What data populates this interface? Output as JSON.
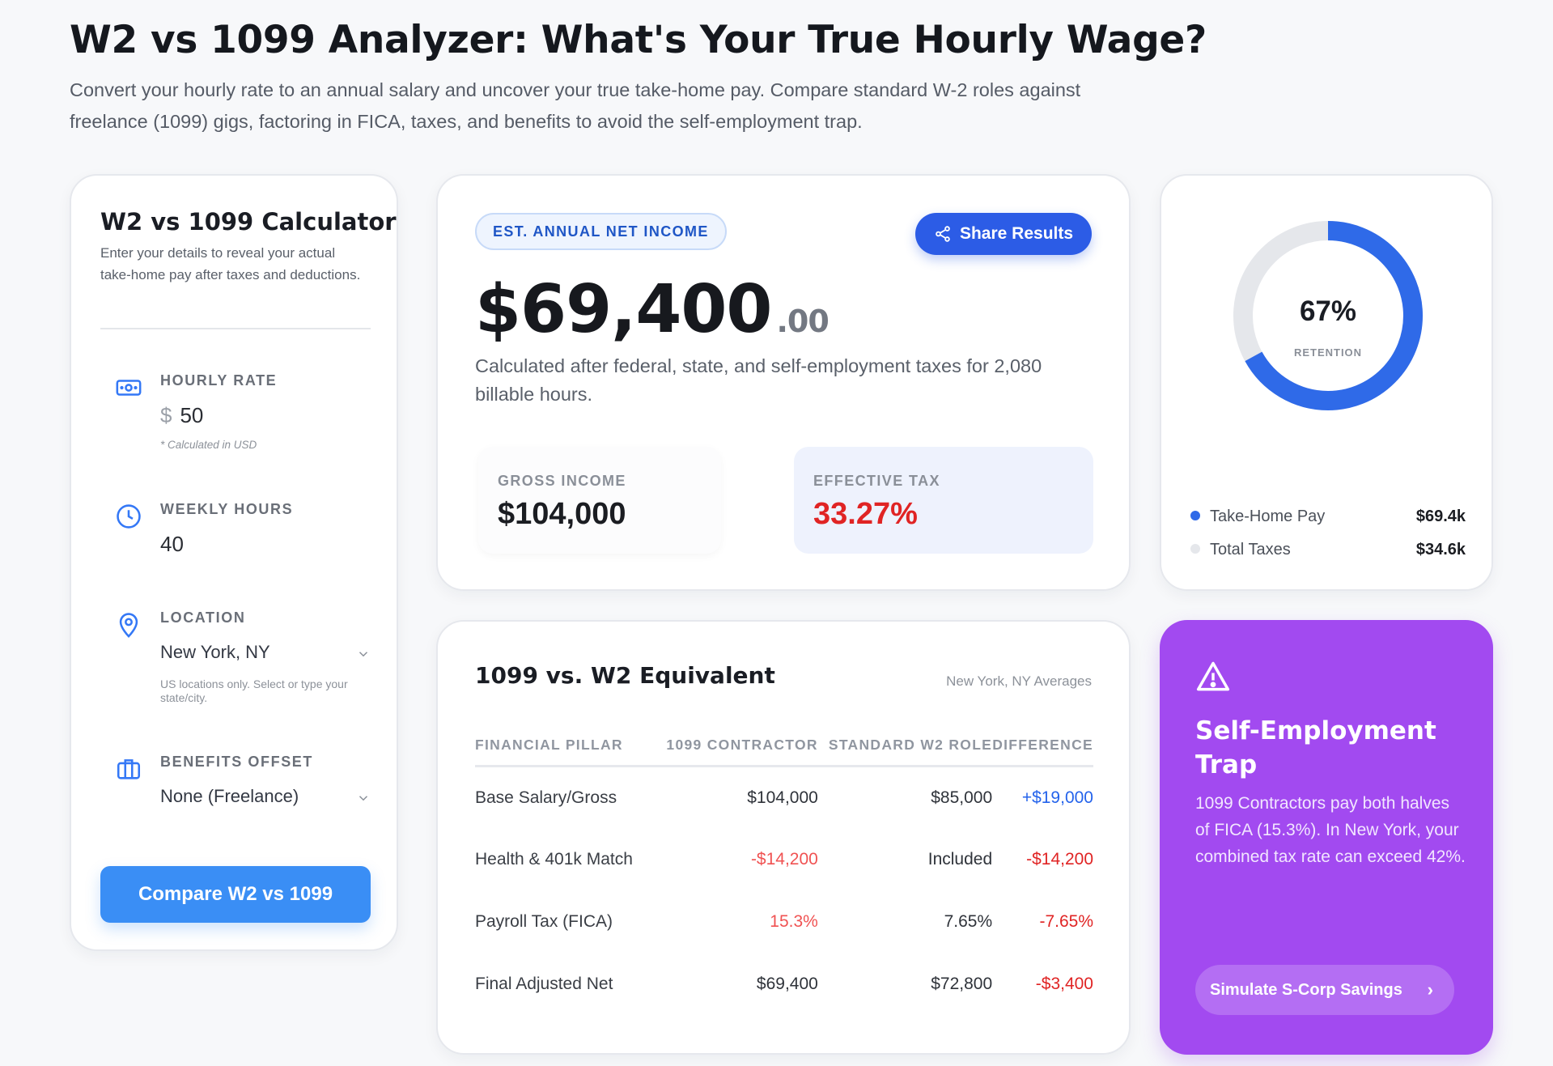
{
  "header": {
    "title": "W2 vs 1099 Analyzer: What's Your True Hourly Wage?",
    "subtitle": "Convert your hourly rate to an annual salary and uncover your true take-home pay. Compare standard W-2 roles against freelance (1099) gigs, factoring in FICA, taxes, and benefits to avoid the self-employment trap."
  },
  "calculator": {
    "title": "W2 vs 1099 Calculator",
    "description": "Enter your details to reveal your actual take-home pay after taxes and deductions.",
    "hourly_rate": {
      "label": "HOURLY RATE",
      "currency": "$",
      "value": "50",
      "note": "* Calculated in USD"
    },
    "weekly_hours": {
      "label": "WEEKLY HOURS",
      "value": "40"
    },
    "location": {
      "label": "LOCATION",
      "value": "New York, NY",
      "note": "US locations only. Select or type your state/city."
    },
    "benefits": {
      "label": "BENEFITS OFFSET",
      "value": "None (Freelance)"
    },
    "compare_label": "Compare W2 vs 1099"
  },
  "net": {
    "pill": "EST. ANNUAL NET INCOME",
    "share_label": "Share Results",
    "amount": "$69,400",
    "cents": ".00",
    "description": "Calculated after federal, state, and self-employment taxes for 2,080 billable hours.",
    "gross_label": "GROSS INCOME",
    "gross_value": "$104,000",
    "tax_label": "EFFECTIVE TAX",
    "tax_value": "33.27%"
  },
  "retention": {
    "percent_value": 67,
    "percent_text": "67%",
    "label": "RETENTION",
    "colors": {
      "take_home": "#2f6ae8",
      "taxes": "#e5e7eb"
    },
    "legend": [
      {
        "name": "Take-Home Pay",
        "value": "$69.4k"
      },
      {
        "name": "Total Taxes",
        "value": "$34.6k"
      }
    ]
  },
  "comparison": {
    "title": "1099 vs. W2 Equivalent",
    "subtitle": "New York, NY Averages",
    "columns": [
      "FINANCIAL PILLAR",
      "1099 CONTRACTOR",
      "STANDARD W2 ROLE",
      "DIFFERENCE"
    ],
    "rows": [
      {
        "pillar": "Base Salary/Gross",
        "contractor": "$104,000",
        "w2": "$85,000",
        "difference": "+$19,000"
      },
      {
        "pillar": "Health & 401k Match",
        "contractor": "-$14,200",
        "w2": "Included",
        "difference": "-$14,200"
      },
      {
        "pillar": "Payroll Tax (FICA)",
        "contractor": "15.3%",
        "w2": "7.65%",
        "difference": "-7.65%"
      },
      {
        "pillar": "Final Adjusted Net",
        "contractor": "$69,400",
        "w2": "$72,800",
        "difference": "-$3,400"
      }
    ]
  },
  "trap": {
    "title": "Self-Employment Trap",
    "description": "1099 Contractors pay both halves of FICA (15.3%). In New York, your combined tax rate can exceed 42%.",
    "button_label": "Simulate S-Corp Savings",
    "button_chevron": "›"
  }
}
